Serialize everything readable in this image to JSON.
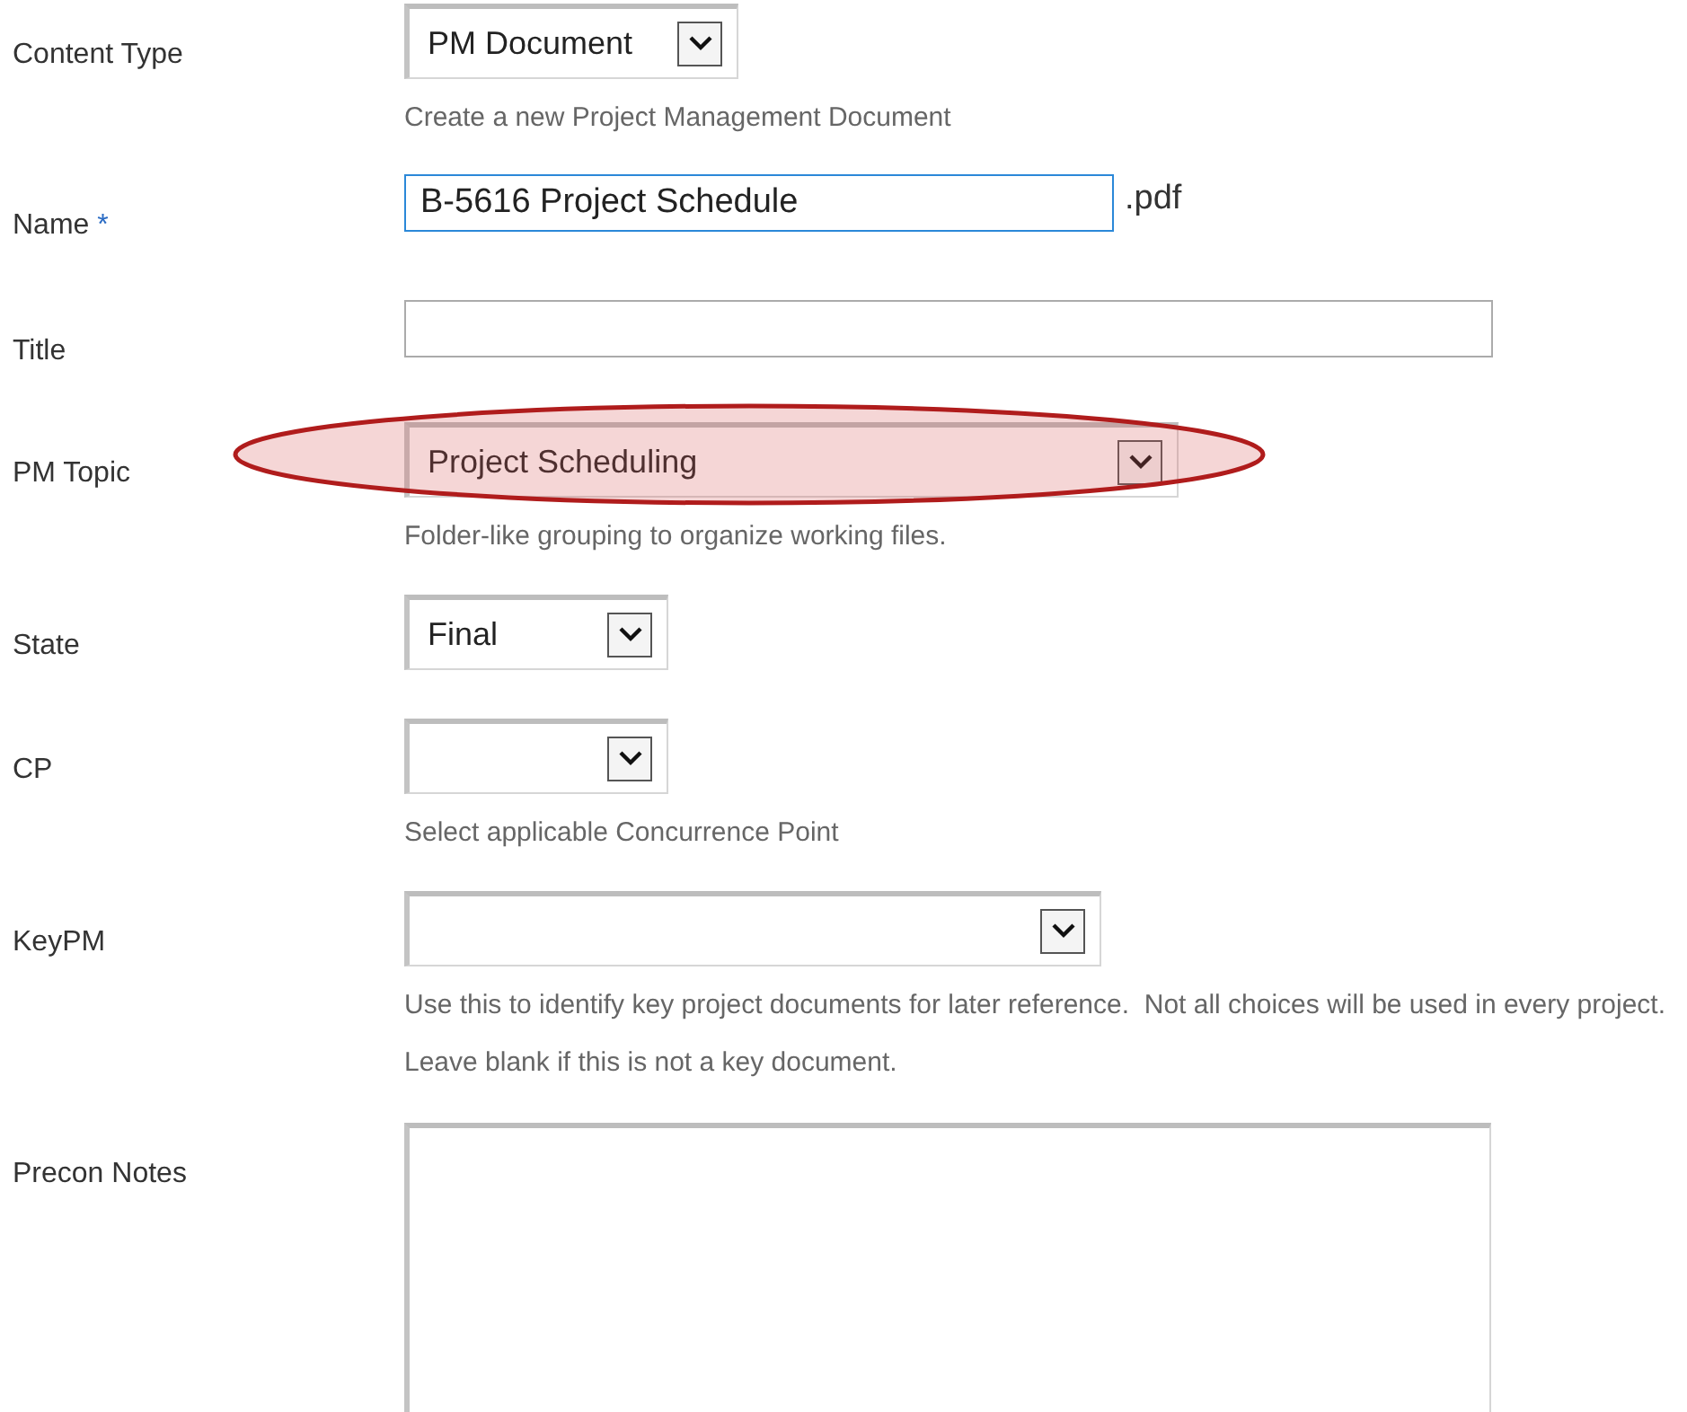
{
  "fields": [
    {
      "kind": "select",
      "label": "Content Type",
      "value": "PM Document",
      "hint": "Create a new Project Management Document",
      "highlighted": false
    },
    {
      "kind": "text",
      "label": "Name",
      "required_mark": "*",
      "value": "B-5616 Project Schedule",
      "suffix": ".pdf",
      "focused": true,
      "highlighted": false
    },
    {
      "kind": "text",
      "label": "Title",
      "focused": false,
      "highlighted": false
    },
    {
      "kind": "select",
      "label": "PM Topic",
      "value": "Project Scheduling",
      "hint": "Folder-like grouping to organize working files.",
      "highlighted": true
    },
    {
      "kind": "select",
      "label": "State",
      "value": "Final",
      "highlighted": false
    },
    {
      "kind": "select",
      "label": "CP",
      "hint": "Select applicable Concurrence Point",
      "highlighted": false
    },
    {
      "kind": "select",
      "label": "KeyPM",
      "hint": "Use this to identify key project documents for later reference.  Not all choices will be used in every project.  Leave blank if this is not a key document.",
      "highlighted": false
    },
    {
      "kind": "textarea",
      "label": "Precon Notes",
      "highlighted": false
    }
  ]
}
